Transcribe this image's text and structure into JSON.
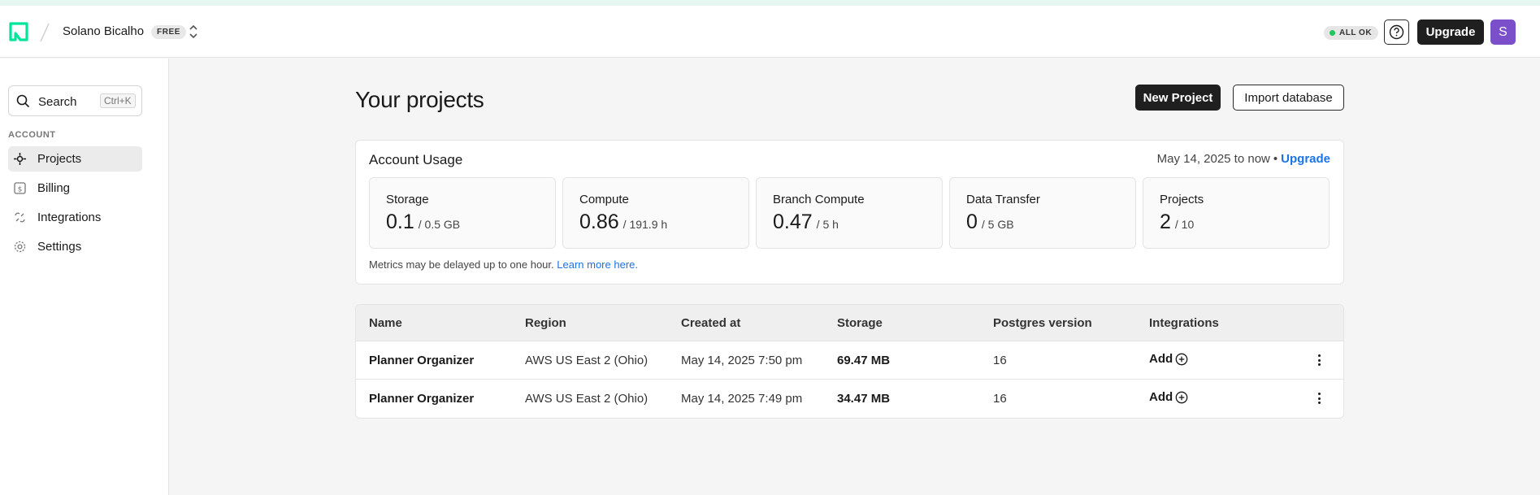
{
  "header": {
    "org_name": "Solano Bicalho",
    "plan_badge": "FREE",
    "status_text": "ALL OK",
    "upgrade_label": "Upgrade",
    "avatar_initial": "S"
  },
  "sidebar": {
    "search_label": "Search",
    "search_shortcut": "Ctrl+K",
    "section_label": "ACCOUNT",
    "items": [
      {
        "label": "Projects",
        "icon": "projects-icon",
        "active": true
      },
      {
        "label": "Billing",
        "icon": "billing-icon",
        "active": false
      },
      {
        "label": "Integrations",
        "icon": "integrations-icon",
        "active": false
      },
      {
        "label": "Settings",
        "icon": "gear-icon",
        "active": false
      }
    ]
  },
  "main": {
    "title": "Your projects",
    "new_project_label": "New Project",
    "import_label": "Import database"
  },
  "usage": {
    "title": "Account Usage",
    "range": "May 14, 2025 to now",
    "separator": "•",
    "upgrade_link": "Upgrade",
    "metrics": [
      {
        "name": "Storage",
        "value": "0.1",
        "limit": "/ 0.5 GB"
      },
      {
        "name": "Compute",
        "value": "0.86",
        "limit": "/ 191.9 h"
      },
      {
        "name": "Branch Compute",
        "value": "0.47",
        "limit": "/ 5 h"
      },
      {
        "name": "Data Transfer",
        "value": "0",
        "limit": "/ 5 GB"
      },
      {
        "name": "Projects",
        "value": "2",
        "limit": "/ 10"
      }
    ],
    "note": "Metrics may be delayed up to one hour.",
    "note_link": "Learn more here."
  },
  "table": {
    "columns": [
      "Name",
      "Region",
      "Created at",
      "Storage",
      "Postgres version",
      "Integrations"
    ],
    "rows": [
      {
        "name": "Planner Organizer",
        "region": "AWS US East 2 (Ohio)",
        "created": "May 14, 2025 7:50 pm",
        "storage": "69.47 MB",
        "pg": "16",
        "integrations": "Add"
      },
      {
        "name": "Planner Organizer",
        "region": "AWS US East 2 (Ohio)",
        "created": "May 14, 2025 7:49 pm",
        "storage": "34.47 MB",
        "pg": "16",
        "integrations": "Add"
      }
    ]
  },
  "colors": {
    "brand_green": "#00e599",
    "accent_blue": "#1a73e8",
    "status_green": "#22c55e",
    "avatar_purple": "#7a4fc9"
  }
}
